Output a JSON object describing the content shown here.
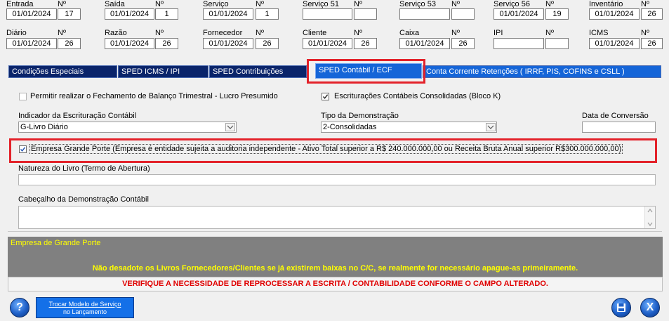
{
  "row1": [
    {
      "label": "Entrada",
      "date": "01/01/2024",
      "no_label": "Nº",
      "no": "17"
    },
    {
      "label": "Saída",
      "date": "01/01/2024",
      "no_label": "Nº",
      "no": "1"
    },
    {
      "label": "Serviço",
      "date": "01/01/2024",
      "no_label": "Nº",
      "no": "1"
    },
    {
      "label": "Serviço 51",
      "date": "",
      "no_label": "Nº",
      "no": ""
    },
    {
      "label": "Serviço 53",
      "date": "",
      "no_label": "Nº",
      "no": ""
    },
    {
      "label": "Serviço 56",
      "date": "01/01/2024",
      "no_label": "Nº",
      "no": "19"
    },
    {
      "label": "Inventário",
      "date": "01/01/2024",
      "no_label": "Nº",
      "no": "26"
    }
  ],
  "row2": [
    {
      "label": "Diário",
      "date": "01/01/2024",
      "no_label": "Nº",
      "no": "26"
    },
    {
      "label": "Razão",
      "date": "01/01/2024",
      "no_label": "Nº",
      "no": "26"
    },
    {
      "label": "Fornecedor",
      "date": "01/01/2024",
      "no_label": "Nº",
      "no": "26"
    },
    {
      "label": "Cliente",
      "date": "01/01/2024",
      "no_label": "Nº",
      "no": "26"
    },
    {
      "label": "Caixa",
      "date": "01/01/2024",
      "no_label": "Nº",
      "no": "26"
    },
    {
      "label": "IPI",
      "date": "",
      "no_label": "Nº",
      "no": ""
    },
    {
      "label": "ICMS",
      "date": "01/01/2024",
      "no_label": "Nº",
      "no": "26"
    }
  ],
  "tabs": [
    "Condições Especiais",
    "SPED ICMS / IPI",
    "SPED Contribuições",
    "SPED Contábil / ECF",
    "Conta Corrente Retenções ( IRRF,  PIS,  COFINS  e  CSLL )"
  ],
  "form": {
    "balanco_label": "Permitir realizar o Fechamento de Balanço Trimestral - Lucro Presumido",
    "consolidadas_label": "Escriturações Contábeis Consolidadas (Bloco K)",
    "indicador_label": "Indicador da Escrituração Contábil",
    "indicador_value": "G-Livro Diário",
    "tipo_label": "Tipo da Demonstração",
    "tipo_value": "2-Consolidadas",
    "conversao_label": "Data de Conversão",
    "conversao_value": "",
    "grande_porte_label": "Empresa Grande Porte (Empresa é entidade sujeita a auditoria independente - Ativo Total superior a R$ 240.000.000,00 ou Receita Bruta Anual superior R$300.000.000,00)",
    "natureza_label": "Natureza do Livro (Termo de Abertura)",
    "natureza_value": "",
    "cabecalho_label": "Cabeçalho da Demonstração Contábil",
    "cabecalho_value": ""
  },
  "info": {
    "title": "Empresa de Grande Porte",
    "warning1": "Não desadote os Livros Fornecedores/Clientes se já existirem baixas no C/C, se realmente for necessário apague-as primeiramente.",
    "warning2": "VERIFIQUE A NECESSIDADE DE REPROCESSAR A ESCRITA / CONTABILIDADE CONFORME O CAMPO ALTERADO."
  },
  "buttons": {
    "help": "?",
    "trocar_line1": "Trocar Modelo de Serviço",
    "trocar_line2": "no Lançamento",
    "close": "X"
  },
  "colors": {
    "tab_dark": "#0a246a",
    "tab_blue": "#1565d8",
    "highlight": "#e3222a",
    "info_bg": "#808080",
    "warning_yellow": "#ffff00",
    "warning_red": "#e00000"
  }
}
